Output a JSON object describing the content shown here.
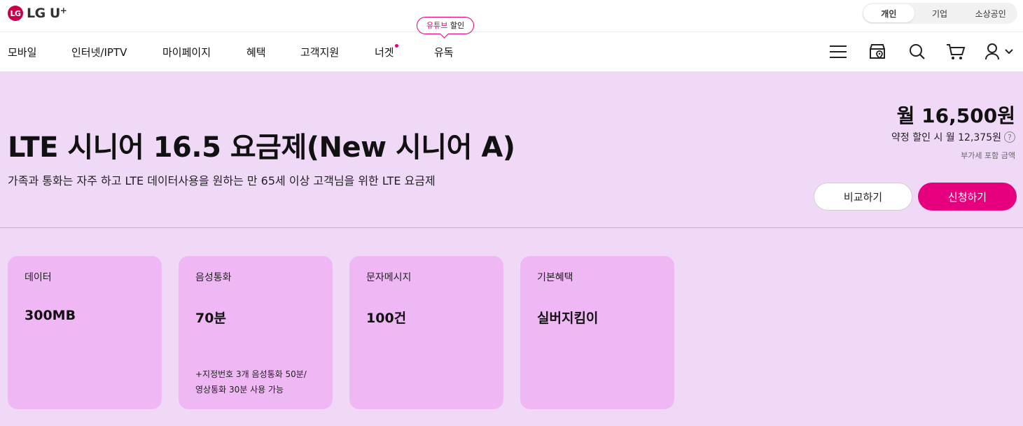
{
  "brand": {
    "logo_mark": "LG",
    "name": "LG U",
    "plus": "+"
  },
  "segment": {
    "items": [
      "개인",
      "기업",
      "소상공인"
    ],
    "active": 0
  },
  "nav": {
    "items": [
      "모바일",
      "인터넷/IPTV",
      "마이페이지",
      "혜택",
      "고객지원",
      "너겟",
      "유독"
    ],
    "promo_pink": "유튜브",
    "promo_rest": " 할인"
  },
  "icons": [
    "menu-icon",
    "store-location-icon",
    "search-icon",
    "cart-icon",
    "user-icon",
    "chevron-down-icon"
  ],
  "hero": {
    "title": "LTE 시니어 16.5 요금제(New 시니어 A)",
    "description": "가족과 통화는 자주 하고 LTE 데이터사용을 원하는 만 65세 이상 고객님을 위한 LTE 요금제",
    "price": "월 16,500원",
    "discount": "약정 할인 시 월 12,375원",
    "help": "?",
    "vat_note": "부가세 포함 금액",
    "compare_label": "비교하기",
    "apply_label": "신청하기"
  },
  "cards": [
    {
      "label": "데이터",
      "value": "300MB",
      "note": ""
    },
    {
      "label": "음성통화",
      "value": "70분",
      "note_line1": "+지정번호 3개 음성통화 50분/",
      "note_line2": "영상통화 30분 사용 가능"
    },
    {
      "label": "문자메시지",
      "value": "100건",
      "note": ""
    },
    {
      "label": "기본혜택",
      "value": "실버지킴이",
      "note": ""
    }
  ],
  "colors": {
    "accent": "#e6007e",
    "brand": "#c6004b",
    "hero_bg": "#f0d9f7",
    "card_bg": "#efb8f5"
  }
}
